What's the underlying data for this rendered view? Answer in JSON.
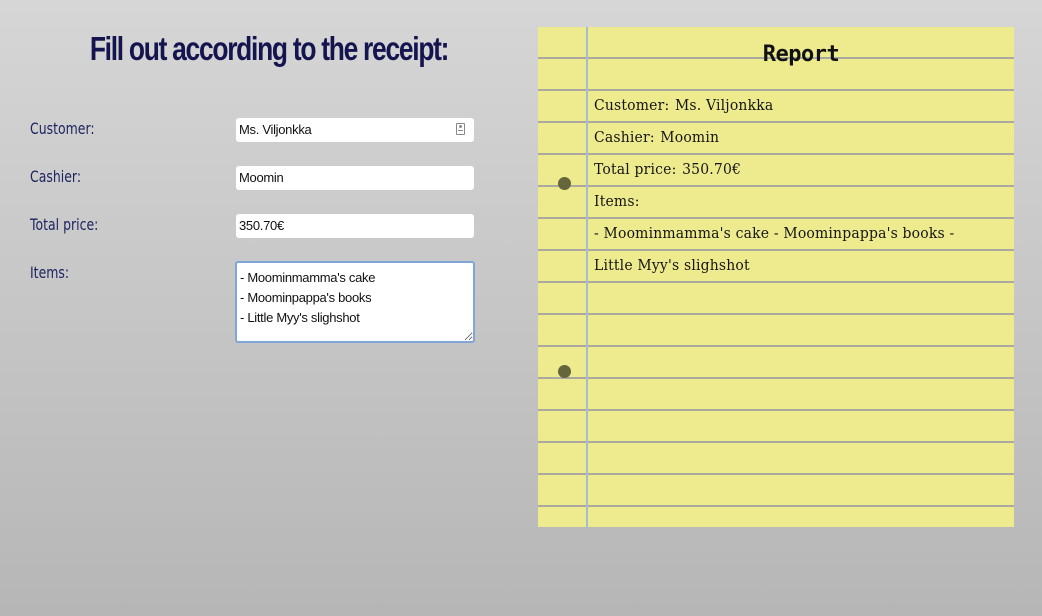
{
  "form": {
    "title": "Fill out according to the receipt:",
    "fields": {
      "customer": {
        "label": "Customer:",
        "value": "Ms. Viljonkka"
      },
      "cashier": {
        "label": "Cashier:",
        "value": "Moomin"
      },
      "total_price": {
        "label": "Total price:",
        "value": "350.70€"
      },
      "items": {
        "label": "Items:",
        "value": "- Moominmamma's cake\n- Moominpappa's books\n- Little Myy's slighshot"
      }
    }
  },
  "report": {
    "title": "Report",
    "customer_label": "Customer:",
    "customer_value": "Ms. Viljonkka",
    "cashier_label": "Cashier:",
    "cashier_value": "Moomin",
    "total_label": "Total price:",
    "total_value": "350.70€",
    "items_label": "Items:",
    "items_line_1": "- Moominmamma's cake - Moominpappa's books -",
    "items_line_2": "Little Myy's slighshot"
  },
  "colors": {
    "title": "#14144e",
    "label": "#1d2560",
    "paper": "#eeeb8e",
    "paper_rule": "#a9a9a0",
    "paper_margin": "#a5bdd2",
    "punch_hole": "#65663c",
    "textarea_focus": "#7fa6d6"
  },
  "icons": {
    "customer_autofill": "contact-card-icon"
  }
}
